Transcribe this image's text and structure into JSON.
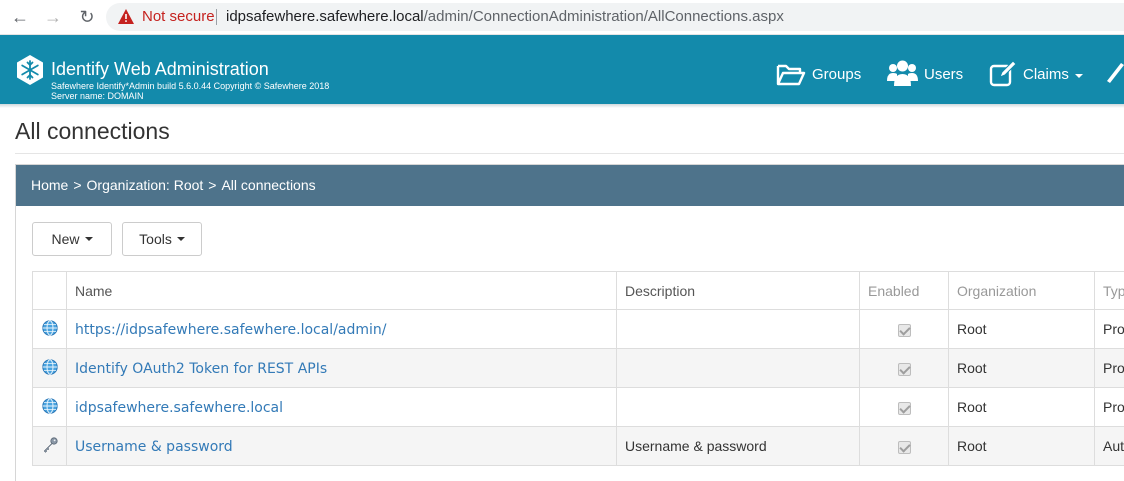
{
  "browser": {
    "not_secure": "Not secure",
    "url_host": "idpsafewhere.safewhere.local",
    "url_path": "/admin/ConnectionAdministration/AllConnections.aspx"
  },
  "header": {
    "title": "Identify Web Administration",
    "subtitle_1": "Safewhere Identify*Admin build 5.6.0.44 Copyright © Safewhere 2018",
    "subtitle_2": "Server name: DOMAIN",
    "nav": {
      "groups": "Groups",
      "users": "Users",
      "claims": "Claims"
    },
    "bar_color": "#138aab"
  },
  "page": {
    "title": "All connections"
  },
  "breadcrumb": {
    "home": "Home",
    "separator": ">",
    "organization": "Organization: Root",
    "current": "All connections"
  },
  "toolbar": {
    "new_label": "New",
    "tools_label": "Tools"
  },
  "table": {
    "columns": [
      "Name",
      "Description",
      "Enabled",
      "Organization",
      "Typ"
    ],
    "rows": [
      {
        "icon": "globe-icon",
        "name": "https://idpsafewhere.safewhere.local/admin/",
        "description": "",
        "enabled": true,
        "organization": "Root",
        "type": "Prot"
      },
      {
        "icon": "globe-icon",
        "name": "Identify OAuth2 Token for REST APIs",
        "description": "",
        "enabled": true,
        "organization": "Root",
        "type": "Prot"
      },
      {
        "icon": "globe-icon",
        "name": "idpsafewhere.safewhere.local",
        "description": "",
        "enabled": true,
        "organization": "Root",
        "type": "Prot"
      },
      {
        "icon": "key-icon",
        "name": "Username & password",
        "description": "Username & password",
        "enabled": true,
        "organization": "Root",
        "type": "Auth"
      }
    ]
  }
}
